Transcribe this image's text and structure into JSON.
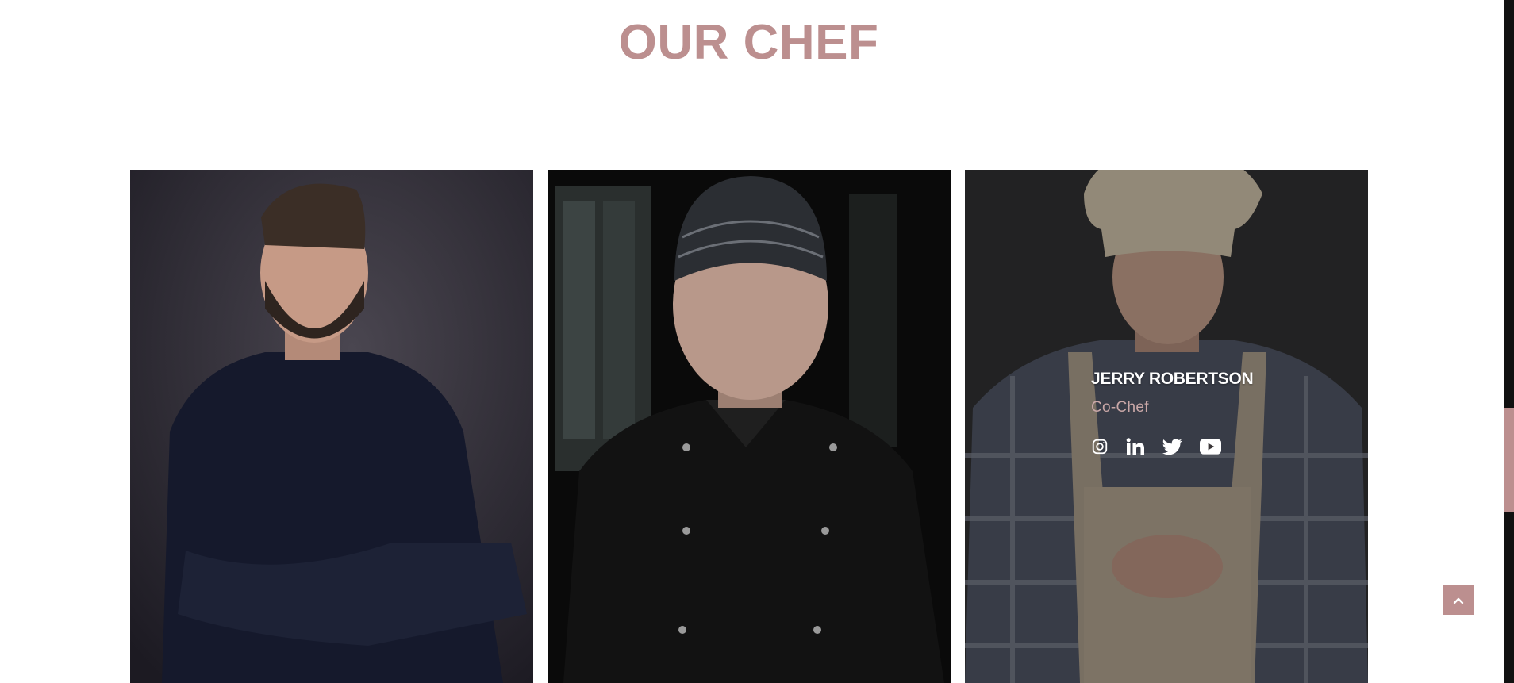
{
  "section": {
    "title": "OUR CHEF"
  },
  "chefs": [
    {
      "photo": "chef-portrait-1"
    },
    {
      "photo": "chef-portrait-2"
    },
    {
      "photo": "chef-portrait-3",
      "name": "JERRY ROBERTSON",
      "role": "Co-Chef",
      "socials": [
        "instagram-icon",
        "linkedin-icon",
        "twitter-icon",
        "youtube-icon"
      ]
    }
  ],
  "controls": {
    "back_to_top_icon": "chevron-up-icon"
  },
  "colors": {
    "accent": "#bc8f8f",
    "scrollbar_track": "#111111"
  }
}
